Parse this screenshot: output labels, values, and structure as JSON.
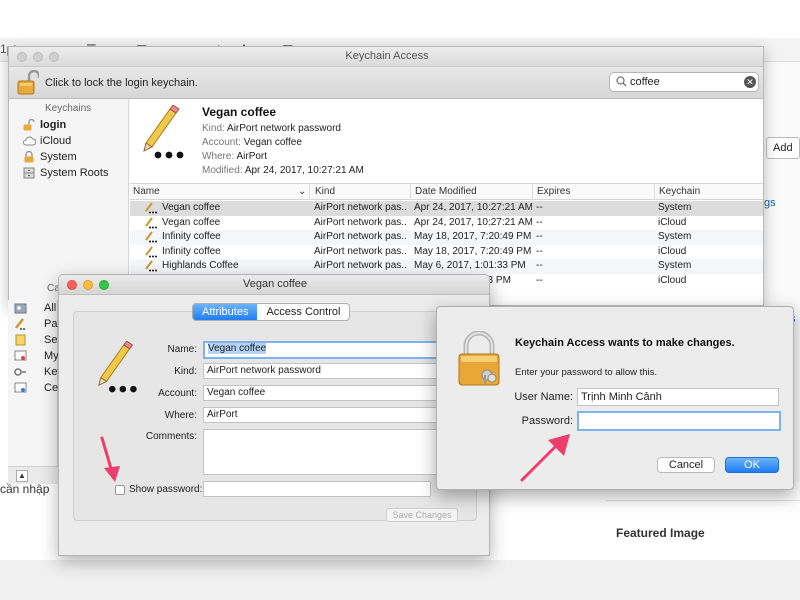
{
  "colors": {
    "accent": "#1f7ef5",
    "selection_row": "#dcdcdc",
    "annotation_arrow": "#ee3d6a",
    "focus_ring": "#7fb3ee"
  },
  "background": {
    "toolbar_fragment": "1pt",
    "add_button": "Add",
    "link_fragment": "gs",
    "link_fragment_2": "s",
    "bottom_text": "cần nhập",
    "featured_image": "Featured Image"
  },
  "keychain_window": {
    "title": "Keychain Access",
    "lock_hint": "Click to lock the login keychain.",
    "search_value": "coffee",
    "search_icon": "magnifier-icon",
    "sidebar_heading": "Keychains",
    "sidebar_items": [
      {
        "label": "login",
        "icon": "open-lock-icon",
        "bold": true
      },
      {
        "label": "iCloud",
        "icon": "cloud-icon"
      },
      {
        "label": "System",
        "icon": "lock-icon"
      },
      {
        "label": "System Roots",
        "icon": "cabinet-icon"
      }
    ],
    "category_heading_fragment": "Ca",
    "category_items": [
      {
        "label": "All I",
        "icon": "key-folder-icon"
      },
      {
        "label": "Pass",
        "icon": "pencil-icon"
      },
      {
        "label": "Sec",
        "icon": "note-icon"
      },
      {
        "label": "My C",
        "icon": "certificate-icon"
      },
      {
        "label": "Keys",
        "icon": "key-icon"
      },
      {
        "label": "Cert",
        "icon": "certificate-icon"
      }
    ],
    "detail": {
      "name": "Vegan coffee",
      "kind_label": "Kind:",
      "kind": "AirPort network password",
      "account_label": "Account:",
      "account": "Vegan coffee",
      "where_label": "Where:",
      "where": "AirPort",
      "modified_label": "Modified:",
      "modified": "Apr 24, 2017, 10:27:21 AM"
    },
    "columns": {
      "name": "Name",
      "kind": "Kind",
      "date": "Date Modified",
      "expires": "Expires",
      "keychain": "Keychain"
    },
    "rows": [
      {
        "name": "Vegan coffee",
        "kind": "AirPort network pas...",
        "date": "Apr 24, 2017, 10:27:21 AM",
        "expires": "--",
        "keychain": "System"
      },
      {
        "name": "Vegan coffee",
        "kind": "AirPort network pas...",
        "date": "Apr 24, 2017, 10:27:21 AM",
        "expires": "--",
        "keychain": "iCloud"
      },
      {
        "name": "Infinity coffee",
        "kind": "AirPort network pas...",
        "date": "May 18, 2017, 7:20:49 PM",
        "expires": "--",
        "keychain": "System"
      },
      {
        "name": "Infinity coffee",
        "kind": "AirPort network pas...",
        "date": "May 18, 2017, 7:20:49 PM",
        "expires": "--",
        "keychain": "iCloud"
      },
      {
        "name": "Highlands Coffee",
        "kind": "AirPort network pas...",
        "date": "May 6, 2017, 1:01:33 PM",
        "expires": "--",
        "keychain": "System"
      },
      {
        "name": "",
        "kind": "",
        "date": "33 PM",
        "expires": "--",
        "keychain": "iCloud"
      }
    ]
  },
  "item_window": {
    "title": "Vegan coffee",
    "tabs": [
      "Attributes",
      "Access Control"
    ],
    "name_label": "Name:",
    "name_value": "Vegan coffee",
    "kind_label": "Kind:",
    "kind_value": "AirPort network password",
    "account_label": "Account:",
    "account_value": "Vegan coffee",
    "where_label": "Where:",
    "where_value": "AirPort",
    "comments_label": "Comments:",
    "show_password_label": "Show password:",
    "show_password_checked": false,
    "save_button": "Save Changes"
  },
  "auth_dialog": {
    "title": "Keychain Access wants to make changes.",
    "message": "Enter your password to allow this.",
    "user_label": "User Name:",
    "user_value": "Trịnh Minh Cảnh",
    "password_label": "Password:",
    "password_value": "",
    "cancel": "Cancel",
    "ok": "OK"
  }
}
